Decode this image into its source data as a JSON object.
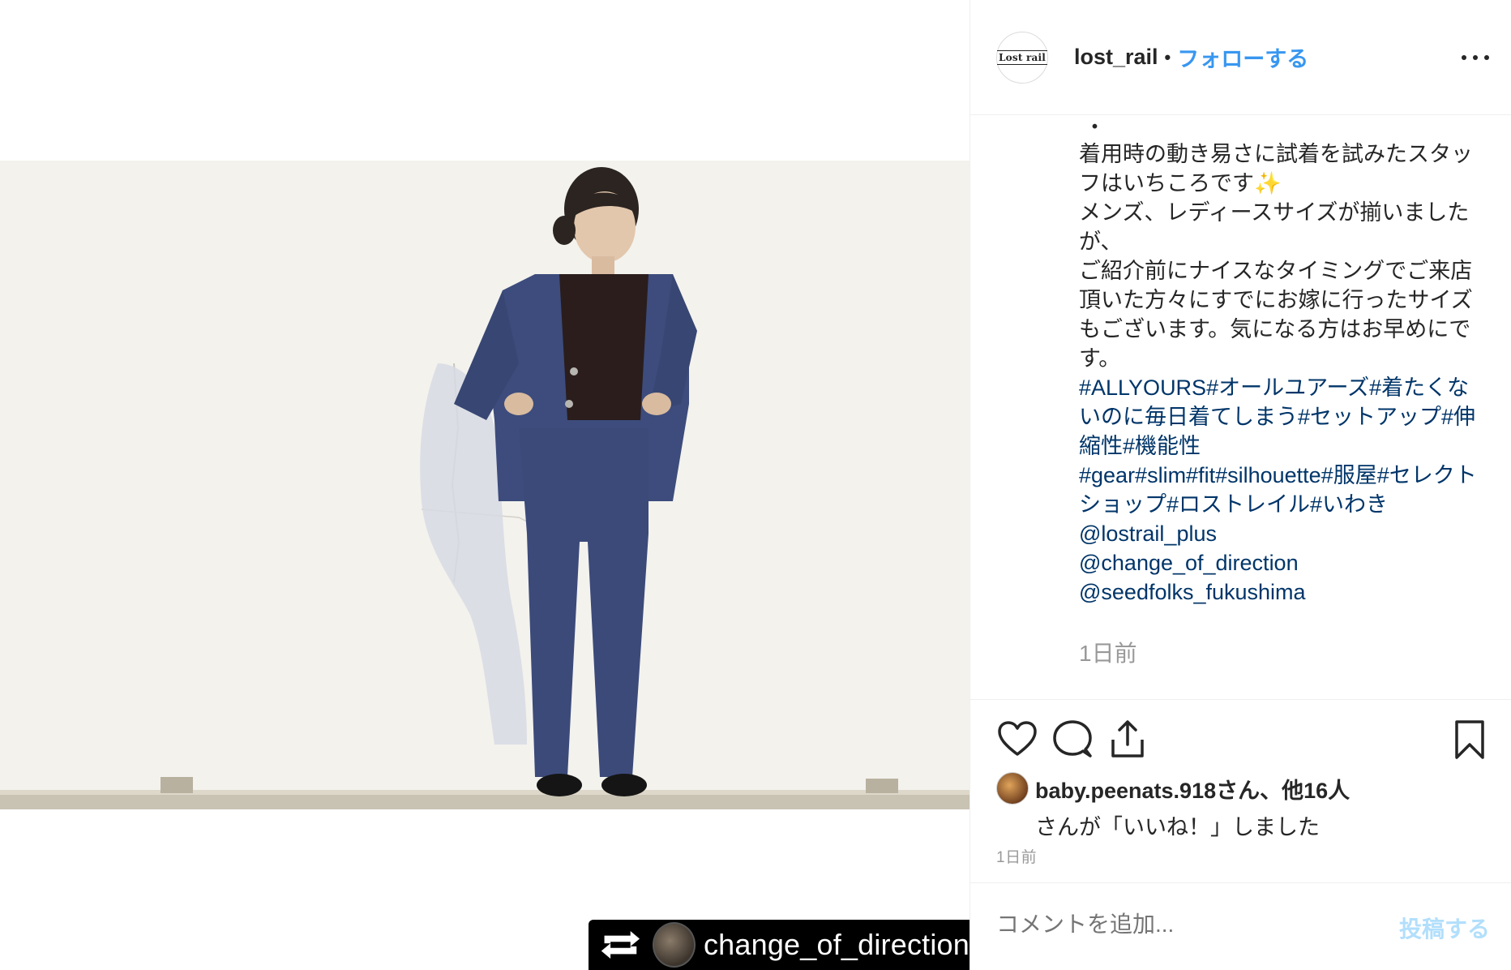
{
  "post": {
    "author": {
      "username": "lost_rail",
      "avatar_text": "Lost rail",
      "separator": "•",
      "follow_label": "フォローする"
    },
    "media": {
      "description_icon": "photo",
      "repost": {
        "icon": "repost-icon",
        "username": "change_of_direction"
      }
    },
    "caption": {
      "bullet": "・",
      "body": "着用時の動き易さに試着を試みたスタッフはいちころです✨\nメンズ、レディースサイズが揃いましたが、\nご紹介前にナイスなタイミングでご来店頂いた方々にすでにお嫁に行ったサイズもございます。気になる方はお早めにです。",
      "hashtags_1": "#ALLYOURS#オールユアーズ#着たくないのに毎日着てしまう#セットアップ#伸縮性#機能性",
      "hashtags_2": "#gear#slim#fit#silhouette#服屋#セレクトショップ#ロストレイル#いわき",
      "mentions": [
        "@lostrail_plus",
        "@change_of_direction",
        "@seedfolks_fukushima"
      ],
      "time": "1日前"
    },
    "actions": {
      "like_icon": "heart-icon",
      "comment_icon": "comment-icon",
      "share_icon": "share-icon",
      "save_icon": "bookmark-icon"
    },
    "likes": {
      "main": "baby.peenats.918さん、他16人",
      "sub": "さんが「いいね！」しました"
    },
    "post_time": "1日前",
    "comment": {
      "placeholder": "コメントを追加...",
      "post_label": "投稿する"
    }
  },
  "colors": {
    "link_blue": "#3897f0",
    "hashtag_blue": "#003569",
    "muted_gray": "#999999",
    "post_disabled": "#b2dffc",
    "divider": "#efefef"
  }
}
